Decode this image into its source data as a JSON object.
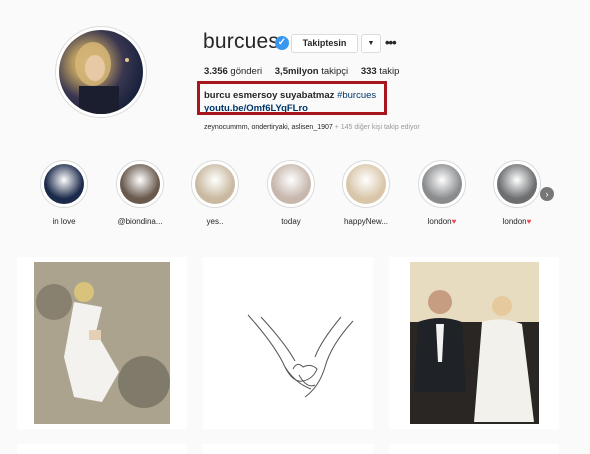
{
  "profile": {
    "username": "burcues",
    "verified_icon": "verified-badge-icon",
    "follow_button": "Takiptesin",
    "dropdown_icon": "▼",
    "more_icon": "•••",
    "stats": {
      "posts_count": "3.356",
      "posts_label": " gönderi",
      "followers_count": "3,5milyon",
      "followers_label": " takipçi",
      "following_count": "333",
      "following_label": " takip"
    },
    "bio_name": "burcu esmersoy suyabatmaz ",
    "bio_tag": "#burcues",
    "bio_link": "youtu.be/Omf6LYqFLro",
    "followed_by_users": "zeynocummm, ondertiryaki, aslisen_1907",
    "followed_by_more": " + 145 diğer kişi takip ediyor"
  },
  "stories": [
    {
      "label": "in love",
      "color": "#1b2a4a"
    },
    {
      "label": "@biondina...",
      "color": "#6a5a4d"
    },
    {
      "label": "yes..",
      "color": "#c9b9a0"
    },
    {
      "label": "today",
      "color": "#c7b7ad"
    },
    {
      "label": "happyNew...",
      "color": "#d9c6a9"
    },
    {
      "label": "london",
      "color": "#8a8c8e",
      "heart": "♥"
    },
    {
      "label": "london",
      "color": "#6c6e70",
      "heart": "♥"
    }
  ],
  "next_icon": "›",
  "colors": {
    "accent_blue": "#3897f0",
    "highlight_red": "#a8161d",
    "link_navy": "#003569"
  }
}
